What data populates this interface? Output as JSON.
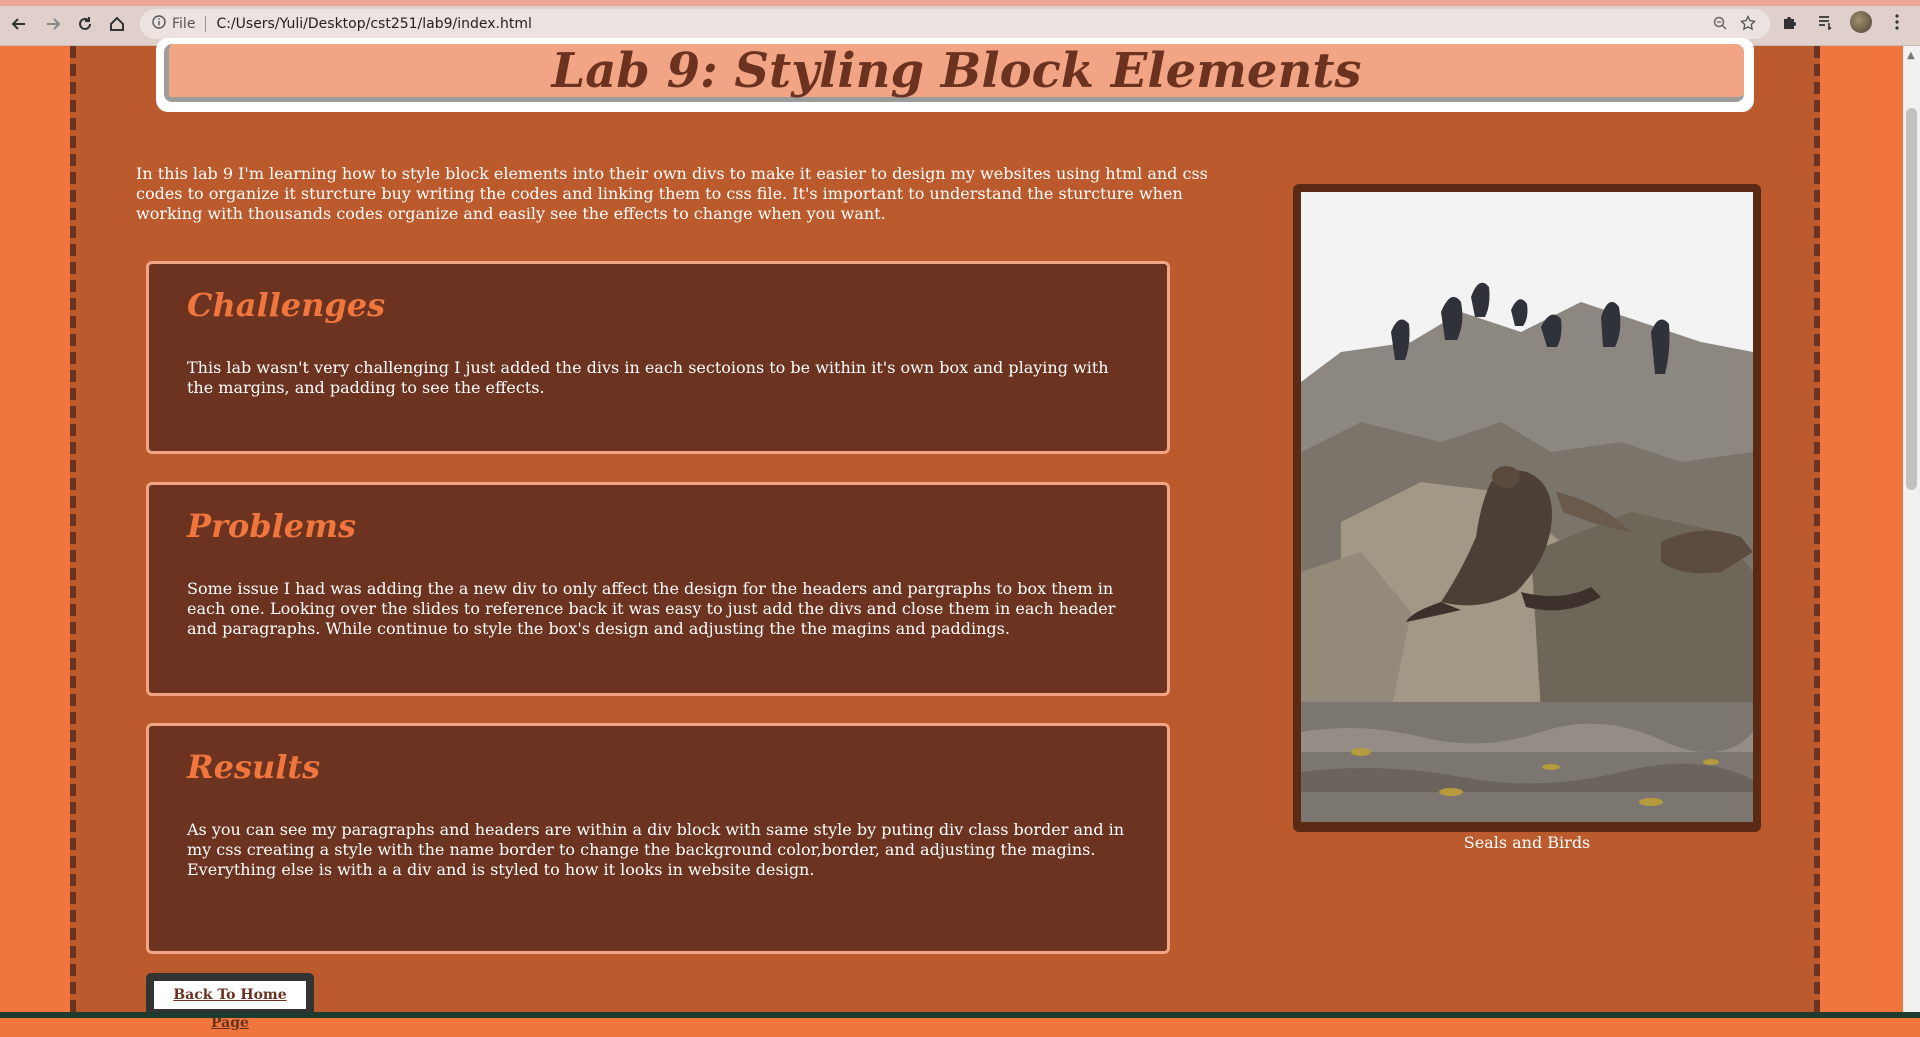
{
  "browser": {
    "scheme_label": "File",
    "url": "C:/Users/Yuli/Desktop/cst251/lab9/index.html"
  },
  "page": {
    "title": "Lab 9: Styling Block Elements",
    "intro": "In this lab 9 I'm learning how to style block elements into their own divs to make it easier to design my websites using html and css codes to organize it sturcture buy writing the codes and linking them to css file. It's important to understand the sturcture when working with thousands codes organize and easily see the effects to change when you want.",
    "sections": [
      {
        "heading": "Challenges",
        "text": "This lab wasn't very challenging I just added the divs in each sectoions to be within it's own box and playing with the margins, and padding to see the effects."
      },
      {
        "heading": "Problems",
        "text": "Some issue I had was adding the a new div to only affect the design for the headers and pargraphs to box them in each one. Looking over the slides to reference back it was easy to just add the divs and close them in each header and paragraphs. While continue to style the box's design and adjusting the the magins and paddings."
      },
      {
        "heading": "Results",
        "text": "As you can see my paragraphs and headers are within a div block with same style by puting div class border and in my css creating a style with the name border to change the background color,border, and adjusting the magins. Everything else is with a a div and is styled to how it looks in website design."
      }
    ],
    "image_caption": "Seals and Birds",
    "home_link": "Back To Home Page"
  },
  "colors": {
    "outer_bg": "#f0763d",
    "page_bg": "#bb5a2c",
    "box_bg": "#6b3320",
    "box_border": "#f2a584",
    "heading": "#f0763d",
    "title_text": "#6b3220"
  }
}
